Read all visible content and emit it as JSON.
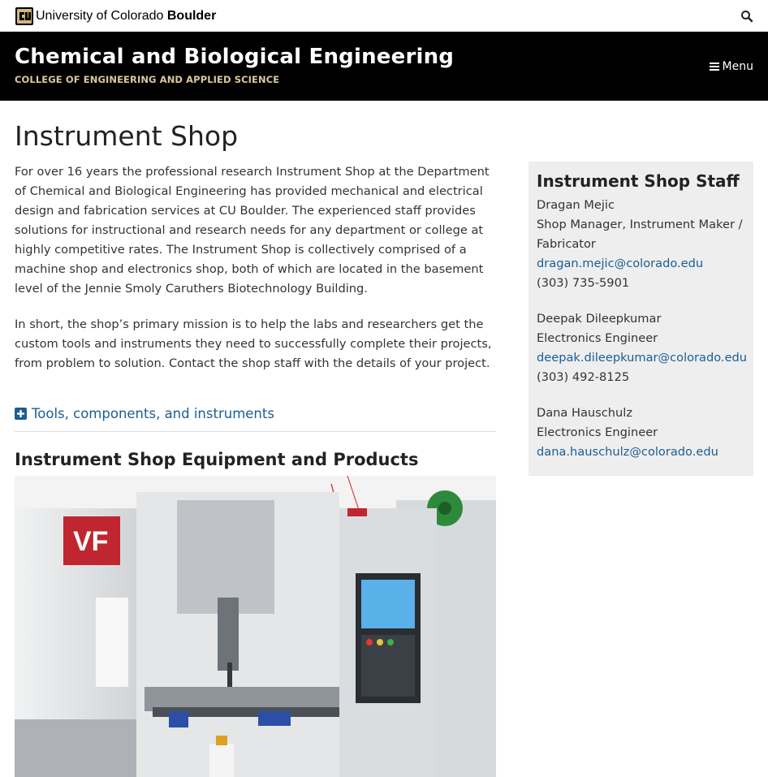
{
  "topbar": {
    "brand_prefix": "University of Colorado",
    "brand_suffix": "Boulder"
  },
  "header": {
    "title": "Chemical and Biological Engineering",
    "subtitle": "COLLEGE OF ENGINEERING AND APPLIED SCIENCE",
    "menu_label": "Menu"
  },
  "page": {
    "title": "Instrument Shop",
    "paragraph_1": "For over 16 years the professional research Instrument Shop at the Department of Chemical and Biological Engineering has provided mechanical and electrical design and fabrication services at CU Boulder. The experienced staff provides solutions for instructional and research needs for any department or college at highly competitive rates. The Instrument Shop is collectively comprised of a machine shop and electronics shop, both of which are located in the basement level of the Jennie Smoly Caruthers Biotechnology Building.",
    "paragraph_2": "In short, the shop’s primary mission is to help the labs and researchers get the custom tools and instruments they need to successfully complete their projects, from problem to solution. Contact the shop staff with the details of your project.",
    "accordion_label": "Tools, components, and instruments",
    "section_heading": "Instrument Shop Equipment and Products"
  },
  "sidebar": {
    "title": "Instrument Shop Staff",
    "staff": [
      {
        "name": "Dragan Mejic",
        "role": "Shop Manager, Instrument Maker / Fabricator",
        "email": "dragan.mejic@colorado.edu",
        "phone": "(303) 735-5901"
      },
      {
        "name": "Deepak Dileepkumar",
        "role": "Electronics Engineer",
        "email": "deepak.dileepkumar@colorado.edu",
        "phone": "(303) 492-8125"
      },
      {
        "name": "Dana Hauschulz",
        "role": "Electronics Engineer",
        "email": "dana.hauschulz@colorado.edu"
      }
    ]
  },
  "colors": {
    "header_bg": "#000000",
    "link": "#1a5e94",
    "sidebar_bg": "#eeeeee"
  },
  "icons": [
    "cu-logo-icon",
    "search-icon",
    "menu-icon",
    "plus-square-icon"
  ]
}
